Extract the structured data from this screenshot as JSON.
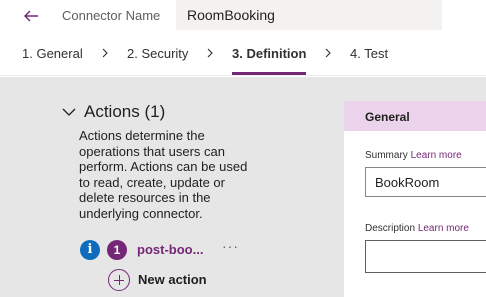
{
  "header": {
    "connector_label": "Connector Name",
    "connector_name_value": "RoomBooking"
  },
  "steps": [
    {
      "label": "1. General"
    },
    {
      "label": "2. Security"
    },
    {
      "label": "3. Definition",
      "active": true
    },
    {
      "label": "4. Test"
    }
  ],
  "actions": {
    "title": "Actions (1)",
    "description": "Actions determine the operations that users can perform. Actions can be used to read, create, update or delete resources in the underlying connector.",
    "items": [
      {
        "info_glyph": "i",
        "number": "1",
        "name": "post-boo...",
        "more": "···"
      }
    ],
    "new_action_label": "New action"
  },
  "general": {
    "title": "General",
    "summary_label": "Summary",
    "summary_learn_more": "Learn more",
    "summary_value": "BookRoom",
    "description_label": "Description",
    "description_learn_more": "Learn more",
    "description_value": ""
  },
  "colors": {
    "accent": "#742774",
    "accent_light": "#ecd3ec",
    "info_blue": "#0f6cbd",
    "body_gray": "#e6e6e6"
  },
  "icons": [
    "back-arrow-icon",
    "chevron-right-icon",
    "chevron-down-icon",
    "info-icon",
    "more-icon",
    "plus-circle-icon"
  ]
}
